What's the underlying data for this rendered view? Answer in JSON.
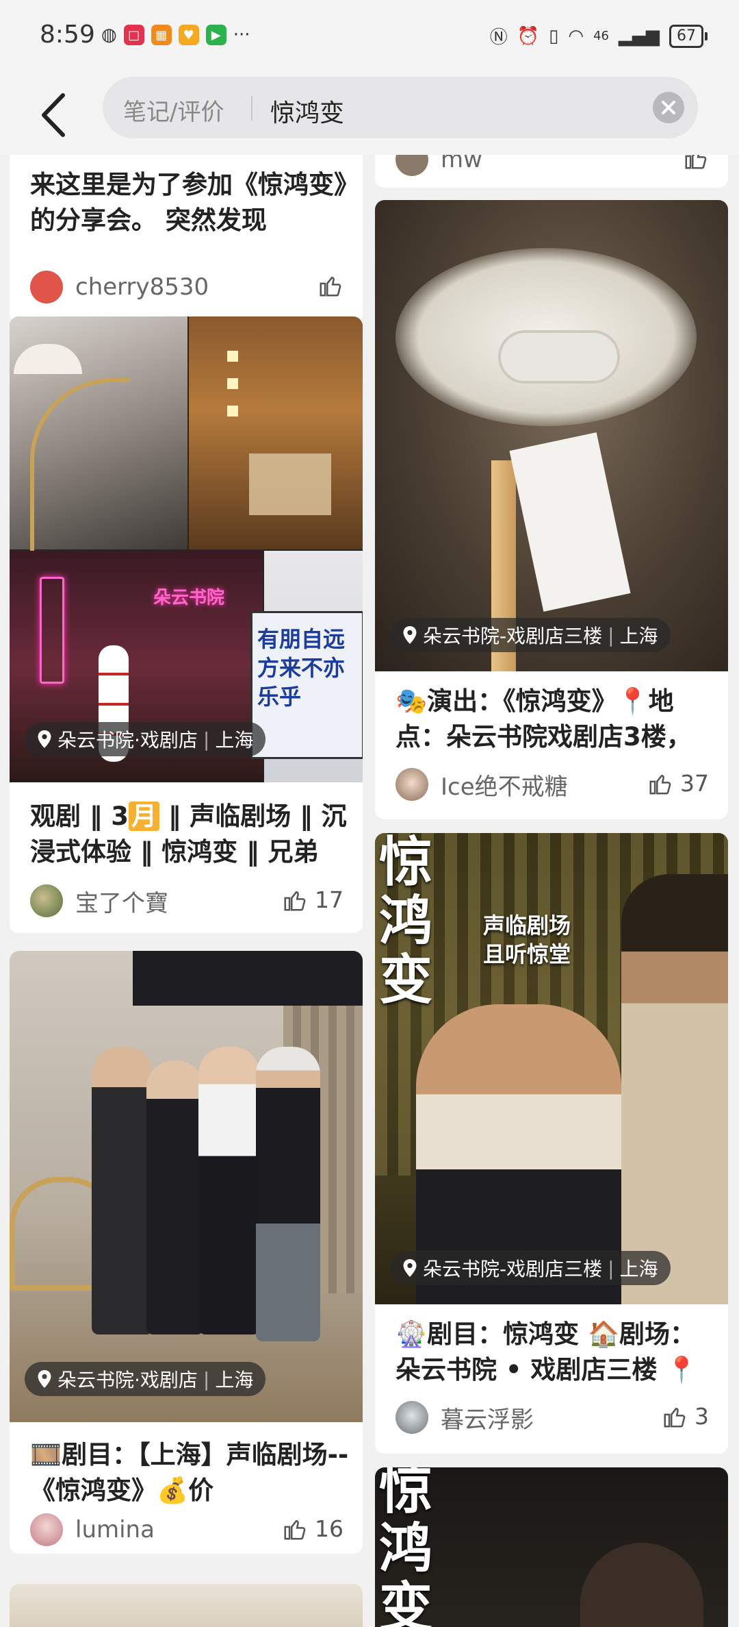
{
  "status_bar": {
    "time": "8:59",
    "signal_text": "46",
    "battery": "67"
  },
  "search": {
    "category": "笔记/评价",
    "query": "惊鸿变"
  },
  "left_column": {
    "card_a": {
      "title": "来这里是为了参加《惊鸿变》的分享会。 突然发现",
      "author": "cherry8530"
    },
    "card_b": {
      "sign_text": "朵云书院",
      "banner_text": "有朋自远方来不亦乐乎",
      "location": {
        "place": "朵云书院·戏剧店",
        "city": "上海"
      },
      "title_pre": "观剧 ‖ 3",
      "title_hl": "月",
      "title_post": " ‖ 声临剧场 ‖ 沉浸式体验 ‖ 惊鸿变 ‖ 兄弟",
      "author": "宝了个寶",
      "likes": "17"
    },
    "card_c": {
      "location": {
        "place": "朵云书院·戏剧店",
        "city": "上海"
      },
      "title": "🎞️剧目：【上海】声临剧场--《惊鸿变》💰价",
      "author": "lumina",
      "likes": "16"
    }
  },
  "right_column": {
    "card_a_author": "mw",
    "card_b": {
      "location": {
        "place": "朵云书院-戏剧店三楼",
        "city": "上海"
      },
      "title": "🎭演出：《惊鸿变》📍地点：朵云书院戏剧店3楼，",
      "author": "Ice绝不戒糖",
      "likes": "37"
    },
    "card_c": {
      "poster_title": "惊鸿变",
      "poster_line1": "声临剧场",
      "poster_line2": "且听惊堂",
      "location": {
        "place": "朵云书院-戏剧店三楼",
        "city": "上海"
      },
      "title": "🎡剧目：惊鸿变 🏠剧场：朵云书院 • 戏剧店三楼 📍",
      "author": "暮云浮影",
      "likes": "3"
    },
    "card_d": {
      "poster_title": "惊鸿变"
    }
  },
  "colors": {
    "accent": "#f6b133",
    "background": "#f1f1f1"
  }
}
